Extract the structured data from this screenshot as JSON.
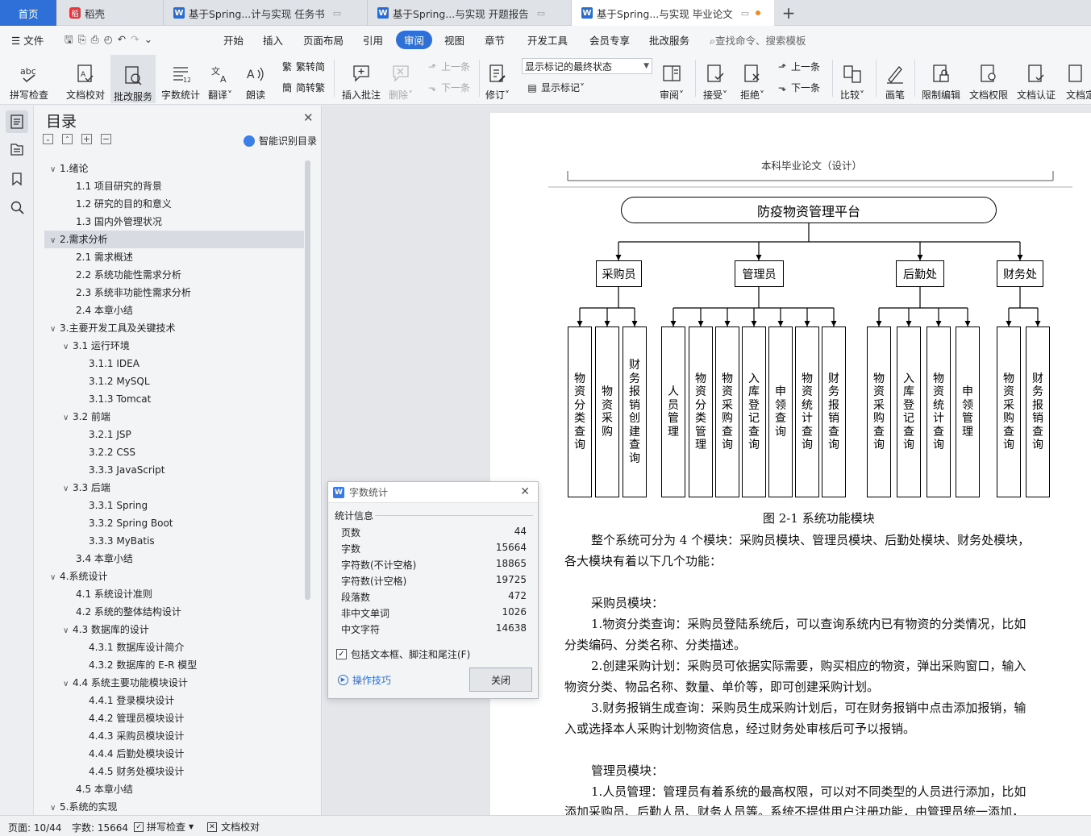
{
  "tabs": [
    {
      "label": "首页"
    },
    {
      "label": "稻壳"
    },
    {
      "label": "基于Spring...计与实现 任务书"
    },
    {
      "label": "基于Spring...与实现 开题报告"
    },
    {
      "label": "基于Spring...与实现 毕业论文"
    }
  ],
  "menu": {
    "file": "文件",
    "items": [
      "开始",
      "插入",
      "页面布局",
      "引用",
      "审阅",
      "视图",
      "章节",
      "开发工具",
      "会员专享",
      "批改服务"
    ],
    "search": "查找命令、搜索模板"
  },
  "ribbon": {
    "spell": "拼写检查",
    "proof": "文档校对",
    "correct": "批改服务",
    "wordcount": "字数统计",
    "translate": "翻译",
    "read": "朗读",
    "t2s": "繁转简",
    "s2t": "简转繁",
    "insert_comment": "插入批注",
    "delete": "删除",
    "prev": "上一条",
    "next": "下一条",
    "revise": "修订",
    "markup_state": "显示标记的最终状态",
    "show_markup": "显示标记",
    "review": "审阅",
    "accept": "接受",
    "reject": "拒绝",
    "prev2": "上一条",
    "next2": "下一条",
    "compare": "比较",
    "pen": "画笔",
    "restrict": "限制编辑",
    "perm": "文档权限",
    "auth": "文档认证",
    "more": "文档定"
  },
  "toc": {
    "title": "目录",
    "smart": "智能识别目录",
    "items": [
      {
        "text": "1.绪论",
        "level": 1,
        "chev": "∨"
      },
      {
        "text": "1.1  项目研究的背景",
        "level": 2
      },
      {
        "text": "1.2  研究的目的和意义",
        "level": 2
      },
      {
        "text": "1.3  国内外管理状况",
        "level": 2
      },
      {
        "text": "2.需求分析",
        "level": 1,
        "chev": "∨",
        "selected": true
      },
      {
        "text": "2.1  需求概述",
        "level": 2
      },
      {
        "text": "2.2  系统功能性需求分析",
        "level": 2
      },
      {
        "text": "2.3  系统非功能性需求分析",
        "level": 2
      },
      {
        "text": "2.4  本章小结",
        "level": 2
      },
      {
        "text": "3.主要开发工具及关键技术",
        "level": 1,
        "chev": "∨"
      },
      {
        "text": "3.1  运行环境",
        "level": 2,
        "chev": "∨"
      },
      {
        "text": "3.1.1  IDEA",
        "level": 3
      },
      {
        "text": "3.1.2  MySQL",
        "level": 3
      },
      {
        "text": "3.1.3  Tomcat",
        "level": 3
      },
      {
        "text": "3.2  前端",
        "level": 2,
        "chev": "∨"
      },
      {
        "text": "3.2.1  JSP",
        "level": 3
      },
      {
        "text": "3.2.2  CSS",
        "level": 3
      },
      {
        "text": "3.3.3  JavaScript",
        "level": 3
      },
      {
        "text": "3.3  后端",
        "level": 2,
        "chev": "∨"
      },
      {
        "text": "3.3.1  Spring",
        "level": 3
      },
      {
        "text": "3.3.2  Spring Boot",
        "level": 3
      },
      {
        "text": "3.3.3  MyBatis",
        "level": 3
      },
      {
        "text": "3.4  本章小结",
        "level": 2
      },
      {
        "text": "4.系统设计",
        "level": 1,
        "chev": "∨"
      },
      {
        "text": "4.1  系统设计准则",
        "level": 2
      },
      {
        "text": "4.2  系统的整体结构设计",
        "level": 2
      },
      {
        "text": "4.3  数据库的设计",
        "level": 2,
        "chev": "∨"
      },
      {
        "text": "4.3.1  数据库设计简介",
        "level": 3
      },
      {
        "text": "4.3.2  数据库的 E-R 模型",
        "level": 3
      },
      {
        "text": "4.4  系统主要功能模块设计",
        "level": 2,
        "chev": "∨"
      },
      {
        "text": "4.4.1  登录模块设计",
        "level": 3
      },
      {
        "text": "4.4.2  管理员模块设计",
        "level": 3
      },
      {
        "text": "4.4.3  采购员模块设计",
        "level": 3
      },
      {
        "text": "4.4.4  后勤处模块设计",
        "level": 3
      },
      {
        "text": "4.4.5  财务处模块设计",
        "level": 3
      },
      {
        "text": "4.5  本章小结",
        "level": 2
      },
      {
        "text": "5.系统的实现",
        "level": 1,
        "chev": "∨"
      }
    ]
  },
  "dialog": {
    "title": "字数统计",
    "section": "统计信息",
    "rows": [
      {
        "label": "页数",
        "value": "44"
      },
      {
        "label": "字数",
        "value": "15664"
      },
      {
        "label": "字符数(不计空格)",
        "value": "18865"
      },
      {
        "label": "字符数(计空格)",
        "value": "19725"
      },
      {
        "label": "段落数",
        "value": "472"
      },
      {
        "label": "非中文单词",
        "value": "1026"
      },
      {
        "label": "中文字符",
        "value": "14638"
      }
    ],
    "checkbox": "包括文本框、脚注和尾注(F)",
    "tips": "操作技巧",
    "close": "关闭"
  },
  "doc": {
    "header": "本科毕业论文（设计）",
    "diagram": {
      "root": "防疫物资管理平台",
      "groups": [
        "采购员",
        "管理员",
        "后勤处",
        "财务处"
      ],
      "leaves": [
        [
          "物资分类查询",
          "物资采购",
          "财务报销创建查询"
        ],
        [
          "人员管理",
          "物资分类管理",
          "物资采购查询",
          "入库登记查询",
          "申领查询",
          "物资统计查询",
          "财务报销查询"
        ],
        [
          "物资采购查询",
          "入库登记查询",
          "物资统计查询",
          "申领管理"
        ],
        [
          "物资采购查询",
          "财务报销查询"
        ]
      ]
    },
    "caption": "图  2-1  系统功能模块",
    "paragraphs": [
      "整个系统可分为 4 个模块：采购员模块、管理员模块、后勤处模块、财务处模块，",
      "各大模块有着以下几个功能：",
      "采购员模块：",
      "1.物资分类查询：采购员登陆系统后，可以查询系统内已有物资的分类情况，比如",
      "分类编码、分类名称、分类描述。",
      "2.创建采购计划：采购员可依据实际需要，购买相应的物资，弹出采购窗口，输入",
      "物资分类、物品名称、数量、单价等，即可创建采购计划。",
      "3.财务报销生成查询：采购员生成采购计划后，可在财务报销中点击添加报销，输",
      "入或选择本人采购计划物资信息，经过财务处审核后可予以报销。",
      "管理员模块：",
      "1.人员管理：管理员有着系统的最高权限，可以对不同类型的人员进行添加，比如",
      "添加采购员、后勤人员、财务人员等。系统不提供用户注册功能，由管理员统一添加，"
    ]
  },
  "status": {
    "page": "页面: 10/44",
    "words": "字数: 15664",
    "spell": "拼写检查",
    "proof": "文档校对"
  }
}
